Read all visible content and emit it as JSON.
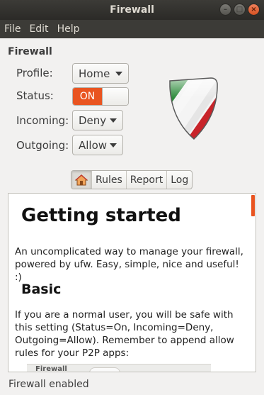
{
  "window": {
    "title": "Firewall",
    "controls": {
      "minimize": "–",
      "maximize": "□",
      "close": "×"
    }
  },
  "menu": [
    "File",
    "Edit",
    "Help"
  ],
  "section_title": "Firewall",
  "fields": {
    "profile": {
      "label": "Profile:",
      "value": "Home"
    },
    "status": {
      "label": "Status:",
      "value": "ON"
    },
    "incoming": {
      "label": "Incoming:",
      "value": "Deny"
    },
    "outgoing": {
      "label": "Outgoing:",
      "value": "Allow"
    }
  },
  "tabs": {
    "home_icon": "home-icon",
    "rules": "Rules",
    "report": "Report",
    "log": "Log"
  },
  "content": {
    "heading": "Getting started",
    "intro": "An uncomplicated way to manage your firewall, powered by ufw. Easy, simple, nice and useful! :)",
    "subheading": "Basic",
    "basic_text": "If you are a normal user, you will be safe with this setting (Status=On, Incoming=Deny, Outgoing=Allow). Remember to append allow rules for your P2P apps:",
    "preview_title": "Firewall"
  },
  "status_bar": "Firewall enabled",
  "colors": {
    "accent": "#e95420",
    "titlebar": "#3c3b37"
  }
}
